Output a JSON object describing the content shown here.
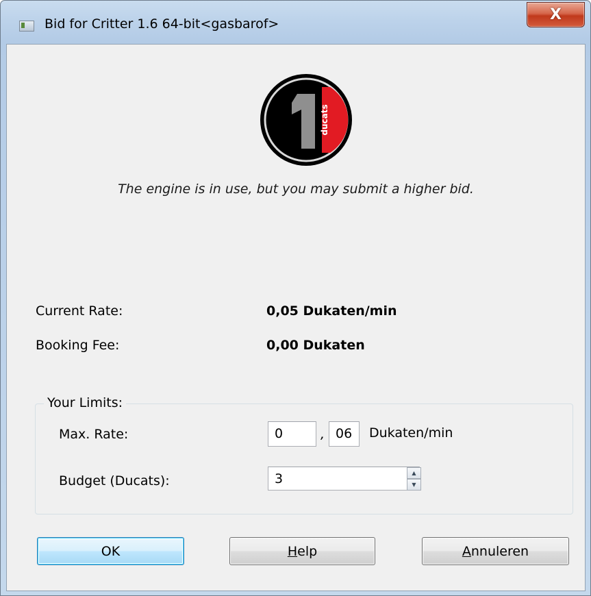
{
  "window": {
    "title": "Bid for Critter 1.6 64-bit<gasbarof>",
    "close_label": "X"
  },
  "logo": {
    "digit": "1",
    "word": "ducats"
  },
  "message": "The engine is in use, but you may submit a higher bid.",
  "info": {
    "current_rate_label": "Current Rate:",
    "current_rate_value": "0,05 Dukaten/min",
    "booking_fee_label": "Booking Fee:",
    "booking_fee_value": "0,00 Dukaten"
  },
  "limits": {
    "title": "Your Limits:",
    "max_rate_label": "Max. Rate:",
    "max_rate_int": "0",
    "decimal_separator": ",",
    "max_rate_frac": "06",
    "max_rate_unit": "Dukaten/min",
    "budget_label": "Budget (Ducats):",
    "budget_value": "3"
  },
  "buttons": {
    "ok": "OK",
    "help_mnemonic": "H",
    "help_rest": "elp",
    "cancel_mnemonic": "A",
    "cancel_rest": "nnuleren"
  },
  "icons": {
    "app": "window-app-icon",
    "close": "close-icon",
    "spin_up": "spin-up-arrow-icon",
    "spin_down": "spin-down-arrow-icon"
  }
}
